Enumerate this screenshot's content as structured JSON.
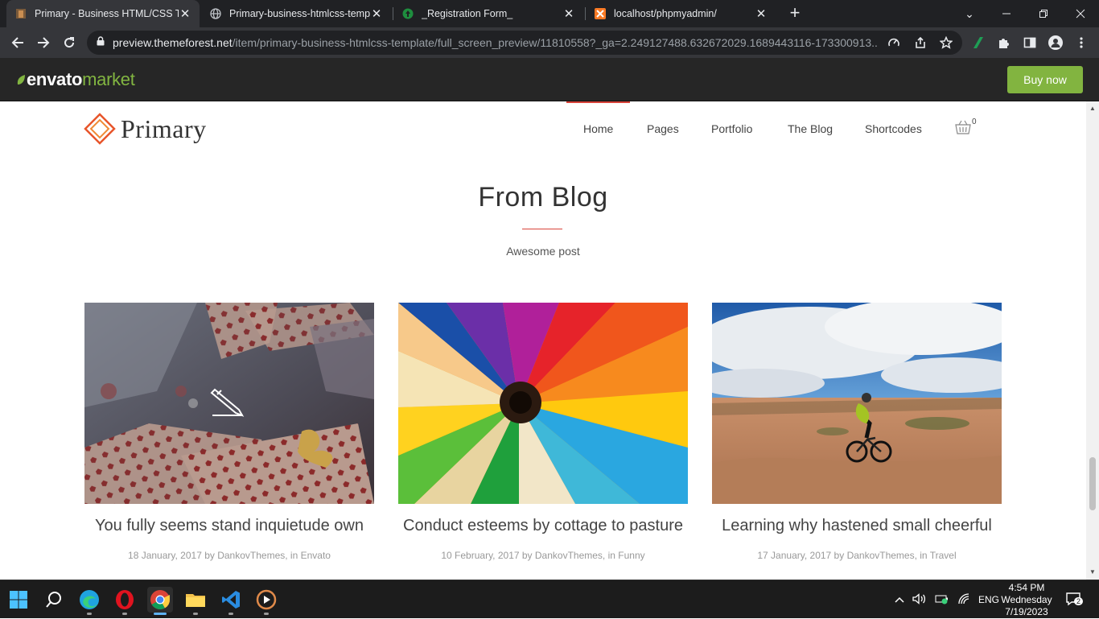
{
  "browser": {
    "tabs": [
      {
        "title": "Primary - Business HTML/CSS Ter",
        "active": true,
        "icon": "primary-favicon"
      },
      {
        "title": "Primary-business-htmlcss-templa",
        "active": false,
        "icon": "globe-icon"
      },
      {
        "title": "_Registration Form_",
        "active": false,
        "icon": "upload-icon"
      },
      {
        "title": "localhost/phpmyadmin/",
        "active": false,
        "icon": "xampp-icon"
      }
    ],
    "url_host": "preview.themeforest.net",
    "url_path": "/item/primary-business-htmlcss-template/full_screen_preview/11810558?_ga=2.249127488.632672029.1689443116-173300913..."
  },
  "envato": {
    "logo_bold": "envato",
    "logo_light": "market",
    "buy_label": "Buy now",
    "brand_color": "#82b440"
  },
  "site": {
    "logo": "Primary",
    "nav": [
      "Home",
      "Pages",
      "Portfolio",
      "The Blog",
      "Shortcodes"
    ],
    "active_nav": "Home",
    "cart_count": "0",
    "accent": "#d9443a"
  },
  "section": {
    "title": "From Blog",
    "subtitle": "Awesome post"
  },
  "posts": [
    {
      "title": "You fully seems stand inquietude own",
      "meta": "18 January, 2017 by DankovThemes, in Envato",
      "image": "gift-wrap-photo"
    },
    {
      "title": "Conduct esteems by cottage to pasture",
      "meta": "10 February, 2017 by DankovThemes, in Funny",
      "image": "colored-pencils-photo"
    },
    {
      "title": "Learning why hastened small cheerful",
      "meta": "17 January, 2017 by DankovThemes, in Travel",
      "image": "mountain-biker-photo"
    }
  ],
  "taskbar": {
    "language": "ENG",
    "time": "4:54 PM",
    "day": "Wednesday",
    "date": "7/19/2023",
    "notifications": "2"
  }
}
